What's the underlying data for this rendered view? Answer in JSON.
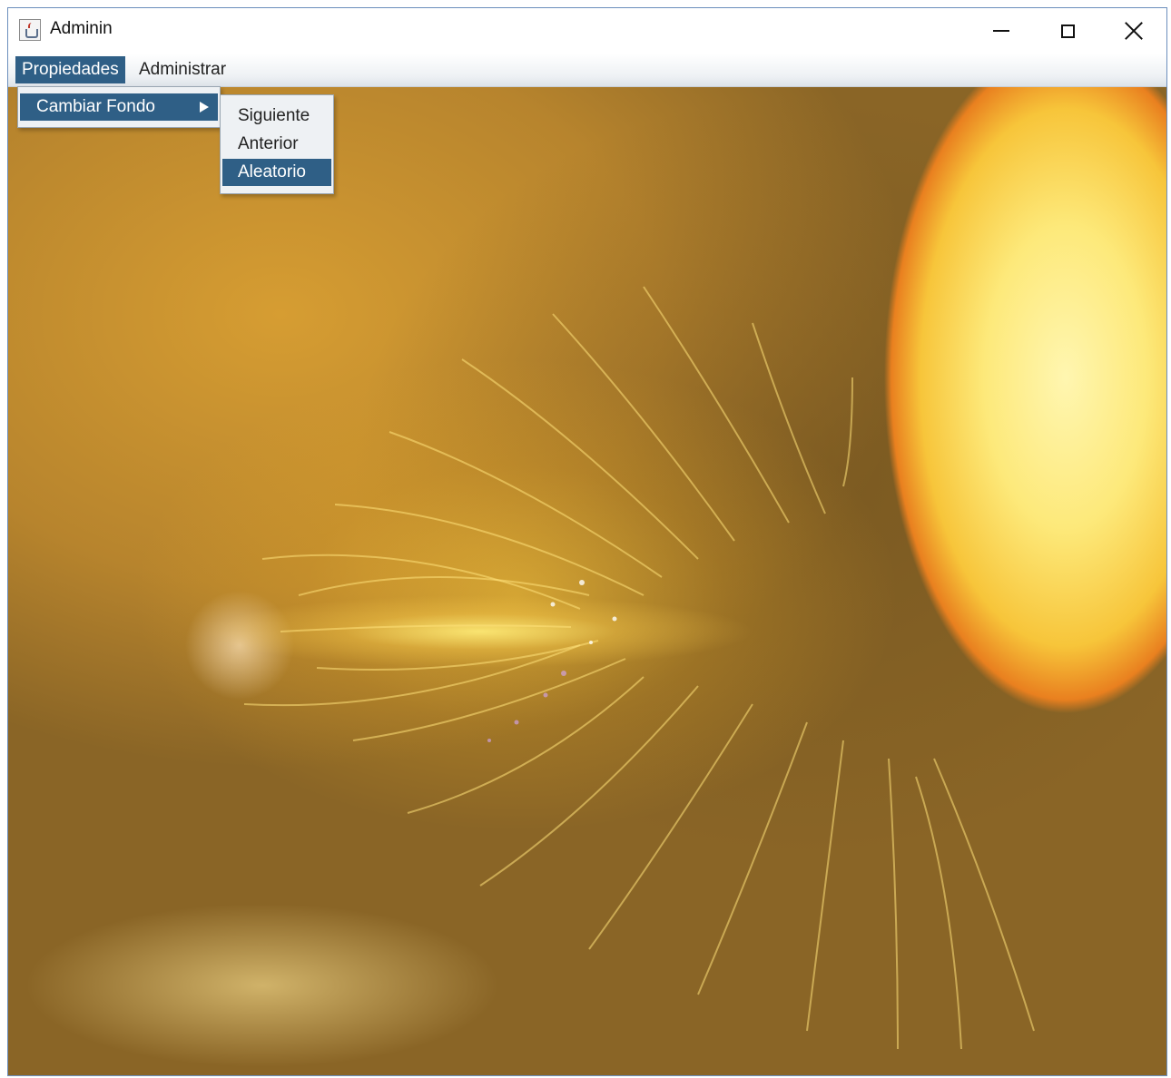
{
  "window": {
    "title": "Adminin",
    "icon": "java-cup-icon"
  },
  "menubar": {
    "items": [
      "Propiedades",
      "Administrar"
    ]
  },
  "menu_propiedades": {
    "items": [
      {
        "label": "Cambiar Fondo",
        "has_submenu": true,
        "highlighted": true
      }
    ]
  },
  "submenu_cambiar_fondo": {
    "items": [
      {
        "label": "Siguiente",
        "highlighted": false
      },
      {
        "label": "Anterior",
        "highlighted": false
      },
      {
        "label": "Aleatorio",
        "highlighted": true
      }
    ]
  },
  "colors": {
    "highlight": "#2f5f86",
    "menu_bg": "#eef1f4"
  }
}
